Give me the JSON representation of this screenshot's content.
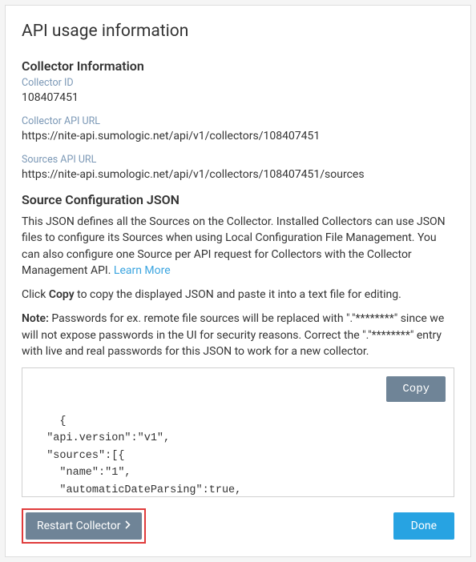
{
  "header": {
    "title": "API usage information"
  },
  "collectorInfo": {
    "sectionTitle": "Collector Information",
    "idLabel": "Collector ID",
    "idValue": "108407451",
    "apiUrlLabel": "Collector API URL",
    "apiUrlValue": "https://nite-api.sumologic.net/api/v1/collectors/108407451",
    "sourcesUrlLabel": "Sources API URL",
    "sourcesUrlValue": "https://nite-api.sumologic.net/api/v1/collectors/108407451/sources"
  },
  "sourceConfig": {
    "heading": "Source Configuration JSON",
    "description": "This JSON defines all the Sources on the Collector. Installed Collectors can use JSON files to configure its Sources when using Local Configuration File Management. You can also configure one Source per API request for Collectors with the Collector Management API.",
    "learnMore": "Learn More",
    "clickPrefix": "Click ",
    "clickCopyWord": "Copy",
    "clickSuffix": " to copy the displayed JSON and paste it into a text file for editing.",
    "notePrefix": "Note:",
    "noteBody": " Passwords for ex. remote file sources will be replaced with \".\"********\" since we will not expose passwords in the UI for security reasons. Correct the \".\"********\" entry with live and real passwords for this JSON to work for a new collector."
  },
  "json": {
    "content": "{\n  \"api.version\":\"v1\",\n  \"sources\":[{\n    \"name\":\"1\",\n    \"automaticDateParsing\":true,\n    \"multilineProcessingEnabled\":true,\n    \"useAutolineMatching\":true,"
  },
  "buttons": {
    "copy": "Copy",
    "restart": "Restart Collector",
    "done": "Done"
  }
}
